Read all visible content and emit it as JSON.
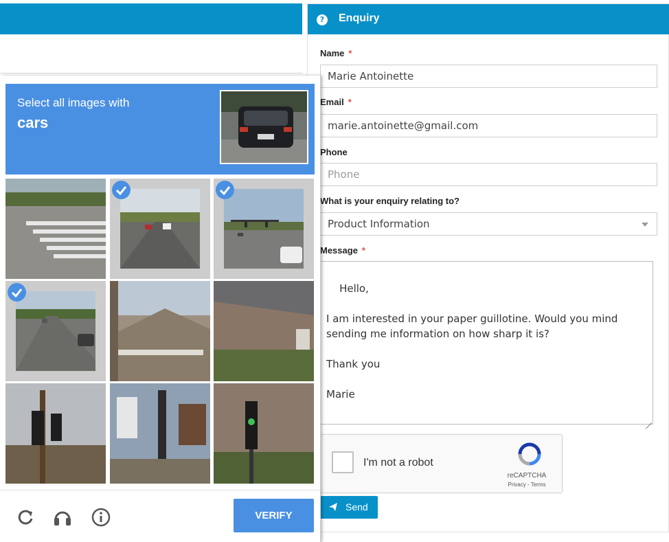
{
  "enquiry": {
    "title": "Enquiry",
    "fields": {
      "name_label": "Name",
      "name_value": "Marie Antoinette",
      "email_label": "Email",
      "email_value": "marie.antoinette@gmail.com",
      "phone_label": "Phone",
      "phone_placeholder": "Phone",
      "topic_label": "What is your enquiry relating to?",
      "topic_value": "Product Information",
      "message_label": "Message",
      "message_value": "Hello,\n\nI am interested in your paper guillotine. Would you mind sending me information on how sharp it is?\n\nThank you\n\nMarie"
    },
    "required_marker": "*",
    "send_label": "Send",
    "colors": {
      "accent": "#0891c9",
      "required": "#d9534f"
    }
  },
  "recaptcha": {
    "checkbox_label": "I'm not a robot",
    "brand": "reCAPTCHA",
    "terms": "Privacy - Terms"
  },
  "challenge": {
    "instruction": "Select all images with",
    "object": "cars",
    "verify_label": "VERIFY",
    "tiles": [
      {
        "scene": "crosswalk",
        "selected": false
      },
      {
        "scene": "highway-cars",
        "selected": true
      },
      {
        "scene": "intersection-cars",
        "selected": true
      },
      {
        "scene": "road-cars",
        "selected": true
      },
      {
        "scene": "house-roof",
        "selected": false
      },
      {
        "scene": "brick-house",
        "selected": false
      },
      {
        "scene": "traffic-light-trees",
        "selected": false
      },
      {
        "scene": "house-porch",
        "selected": false
      },
      {
        "scene": "traffic-light-street",
        "selected": false
      }
    ],
    "footer_icons": [
      "reload-icon",
      "audio-icon",
      "info-icon"
    ],
    "colors": {
      "accent": "#4a90e2"
    }
  }
}
